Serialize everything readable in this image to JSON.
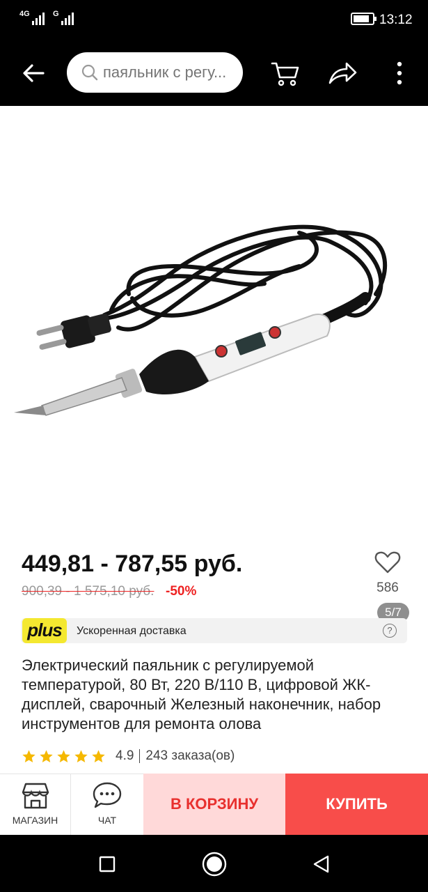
{
  "status_bar": {
    "network1": "4G",
    "network2": "G",
    "time": "13:12",
    "battery_level": 0.85
  },
  "app_bar": {
    "search_placeholder": "паяльник с регу..."
  },
  "gallery": {
    "counter": "5/7"
  },
  "product": {
    "price": "449,81 - 787,55 руб.",
    "old_price": "900,39 - 1 575,10 руб.",
    "discount": "-50%",
    "favorites_count": "586",
    "title": "Электрический паяльник с регулируемой температурой, 80 Вт, 220 В/110 В, цифровой ЖК-дисплей, сварочный Железный наконечник, набор инструментов для ремонта олова",
    "rating": "4.9",
    "orders": "243 заказа(ов)",
    "stars": 5
  },
  "plus_banner": {
    "logo": "plus",
    "text": "Ускоренная доставка",
    "help": "?"
  },
  "bottom_bar": {
    "store_label": "МАГАЗИН",
    "chat_label": "ЧАТ",
    "cart_label": "В КОРЗИНУ",
    "buy_label": "КУПИТЬ"
  },
  "colors": {
    "accent_red": "#f84d4a",
    "cart_bg": "#ffd9d9",
    "star_yellow": "#f5b800",
    "plus_yellow": "#f4e830"
  }
}
